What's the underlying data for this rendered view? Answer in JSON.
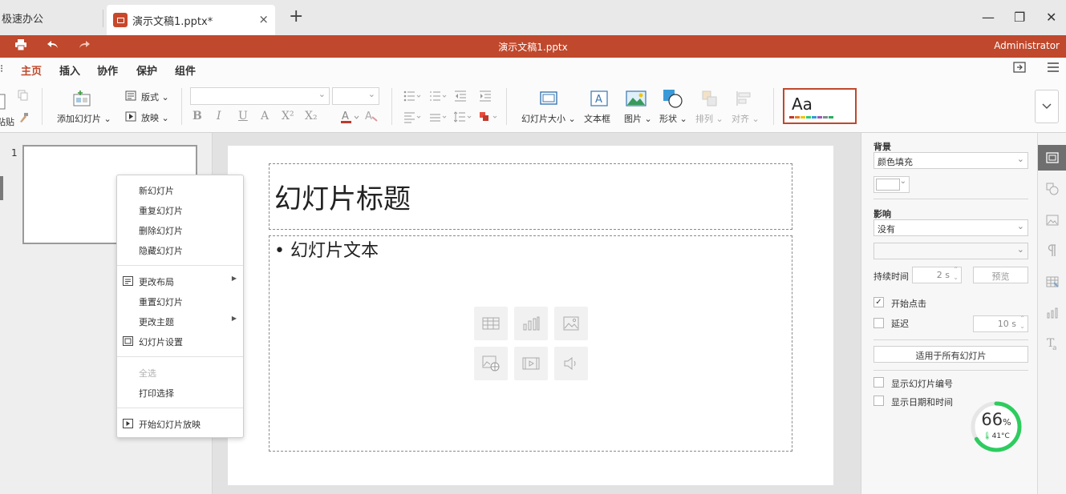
{
  "tabs": {
    "home_label": "极速办公",
    "active_label": "演示文稿1.pptx*",
    "close_glyph": "×",
    "add_glyph": "+"
  },
  "window": {
    "minimize": "—",
    "restore": "❐",
    "close": "✕"
  },
  "titlebar": {
    "doc_title": "演示文稿1.pptx",
    "user": "Administrator",
    "accent_color": "#c0482c"
  },
  "menu": {
    "items": [
      "主页",
      "插入",
      "协作",
      "保护",
      "组件"
    ],
    "active_index": 0
  },
  "ribbon": {
    "paste_label": "粘贴",
    "add_slide_label": "添加幻灯片",
    "layout_label": "版式",
    "play_label": "放映",
    "format_buttons": [
      "B",
      "I",
      "U",
      "A",
      "X²",
      "X₂"
    ],
    "slide_size_label": "幻灯片大小",
    "textbox_label": "文本框",
    "picture_label": "图片",
    "shape_label": "形状",
    "arrange_label": "排列",
    "align_label": "对齐",
    "theme_preview_text": "Aa",
    "theme_colors": [
      "#c0392b",
      "#e67e22",
      "#f1c40f",
      "#2ecc71",
      "#3498db",
      "#9b59b6",
      "#7f8c8d",
      "#27ae60"
    ]
  },
  "slides_panel": {
    "slide_number": "1"
  },
  "slide": {
    "title_placeholder": "幻灯片标题",
    "body_placeholder": "• 幻灯片文本",
    "insert_icons": [
      "table-icon",
      "chart-icon",
      "image-icon",
      "online-image-icon",
      "video-icon",
      "audio-icon"
    ]
  },
  "context_menu": {
    "new_slide": "新幻灯片",
    "duplicate_slide": "重复幻灯片",
    "delete_slide": "删除幻灯片",
    "hide_slide": "隐藏幻灯片",
    "change_layout": "更改布局",
    "reset_slide": "重置幻灯片",
    "change_theme": "更改主题",
    "slide_settings": "幻灯片设置",
    "select_all": "全选",
    "print_selection": "打印选择",
    "start_slideshow": "开始幻灯片放映"
  },
  "properties": {
    "background_label": "背景",
    "background_fill": "颜色填充",
    "background_color": "#ffffff",
    "effect_label": "影响",
    "effect_value": "没有",
    "duration_label": "持续时间",
    "duration_value": "2 s",
    "preview_button": "预览",
    "start_on_click_label": "开始点击",
    "start_on_click_checked": true,
    "delay_label": "延迟",
    "delay_checked": false,
    "delay_value": "10 s",
    "apply_all_button": "适用于所有幻灯片",
    "show_slide_number_label": "显示幻灯片编号",
    "show_date_time_label": "显示日期和时间",
    "check_mark": "✓"
  },
  "side_strip": {
    "icons": [
      "slide-settings-icon",
      "shape-settings-icon",
      "image-settings-icon",
      "paragraph-settings-icon",
      "table-settings-icon",
      "chart-settings-icon",
      "text-art-settings-icon"
    ]
  },
  "system_widget": {
    "percent": "66",
    "percent_sign": "%",
    "temperature": "41°C",
    "ring_color": "#2ecc5f",
    "level": 0.66
  }
}
